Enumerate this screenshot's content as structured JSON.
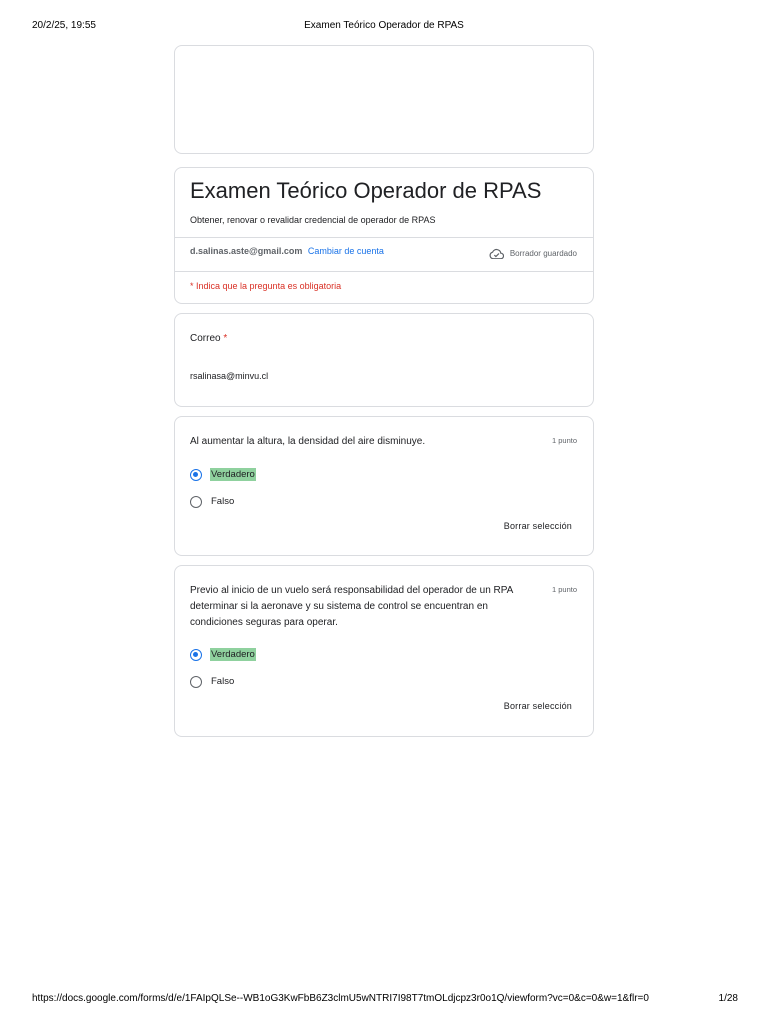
{
  "print": {
    "datetime": "20/2/25, 19:55",
    "page_title": "Examen Teórico Operador de RPAS",
    "url": "https://docs.google.com/forms/d/e/1FAIpQLSe--WB1oG3KwFbB6Z3clmU5wNTRI7I98T7tmOLdjcpz3r0o1Q/viewform?vc=0&c=0&w=1&flr=0",
    "page_number": "1/28"
  },
  "form": {
    "title": "Examen Teórico Operador de RPAS",
    "description": "Obtener, renovar o revalidar credencial de operador de RPAS",
    "account_email": "d.salinas.aste@gmail.com",
    "switch_account": "Cambiar de cuenta",
    "draft_status": "Borrador guardado",
    "required_note": "* Indica que la pregunta es obligatoria"
  },
  "email_question": {
    "label": "Correo",
    "required_mark": "*",
    "answer": "rsalinasa@minvu.cl"
  },
  "questions": [
    {
      "text": "Al aumentar la altura, la densidad del aire disminuye.",
      "points": "1 punto",
      "options": [
        "Verdadero",
        "Falso"
      ],
      "selected": "Verdadero",
      "clear": "Borrar selección"
    },
    {
      "text": "Previo al inicio de un vuelo será responsabilidad del operador de un RPA determinar si la aeronave y su sistema de control se encuentran en condiciones seguras para operar.",
      "points": "1 punto",
      "options": [
        "Verdadero",
        "Falso"
      ],
      "selected": "Verdadero",
      "clear": "Borrar selección"
    }
  ],
  "colors": {
    "accent": "#1a73e8",
    "required": "#d93025",
    "correct_highlight": "#8fd19e",
    "border": "#dadce0"
  },
  "icons": {
    "draft": "cloud-check-icon"
  }
}
